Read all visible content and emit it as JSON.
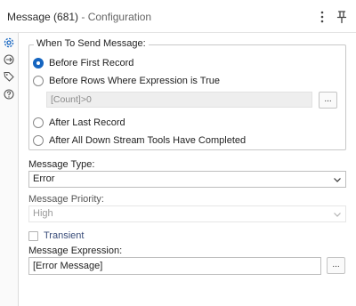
{
  "header": {
    "title": "Message (681)",
    "subtitle": "- Configuration",
    "menu_icon": "kebab-menu-icon",
    "pin_icon": "pin-icon"
  },
  "rail": {
    "icons": [
      "gear-icon",
      "connection-icon",
      "tag-icon",
      "help-icon"
    ],
    "active_color": "#1565c0"
  },
  "when_to_send": {
    "legend": "When To Send Message:",
    "options": [
      {
        "label": "Before First Record",
        "checked": true
      },
      {
        "label": "Before Rows Where Expression is True",
        "checked": false
      },
      {
        "label": "After Last Record",
        "checked": false
      },
      {
        "label": "After All Down Stream Tools Have Completed",
        "checked": false
      }
    ],
    "expression_value": "[Count]>0",
    "expression_button": "..."
  },
  "message_type": {
    "label": "Message Type:",
    "value": "Error"
  },
  "message_priority": {
    "label": "Message Priority:",
    "value": "High",
    "disabled": true
  },
  "transient": {
    "label": "Transient",
    "checked": false
  },
  "message_expression": {
    "label": "Message Expression:",
    "value": "[Error Message]",
    "button": "..."
  }
}
